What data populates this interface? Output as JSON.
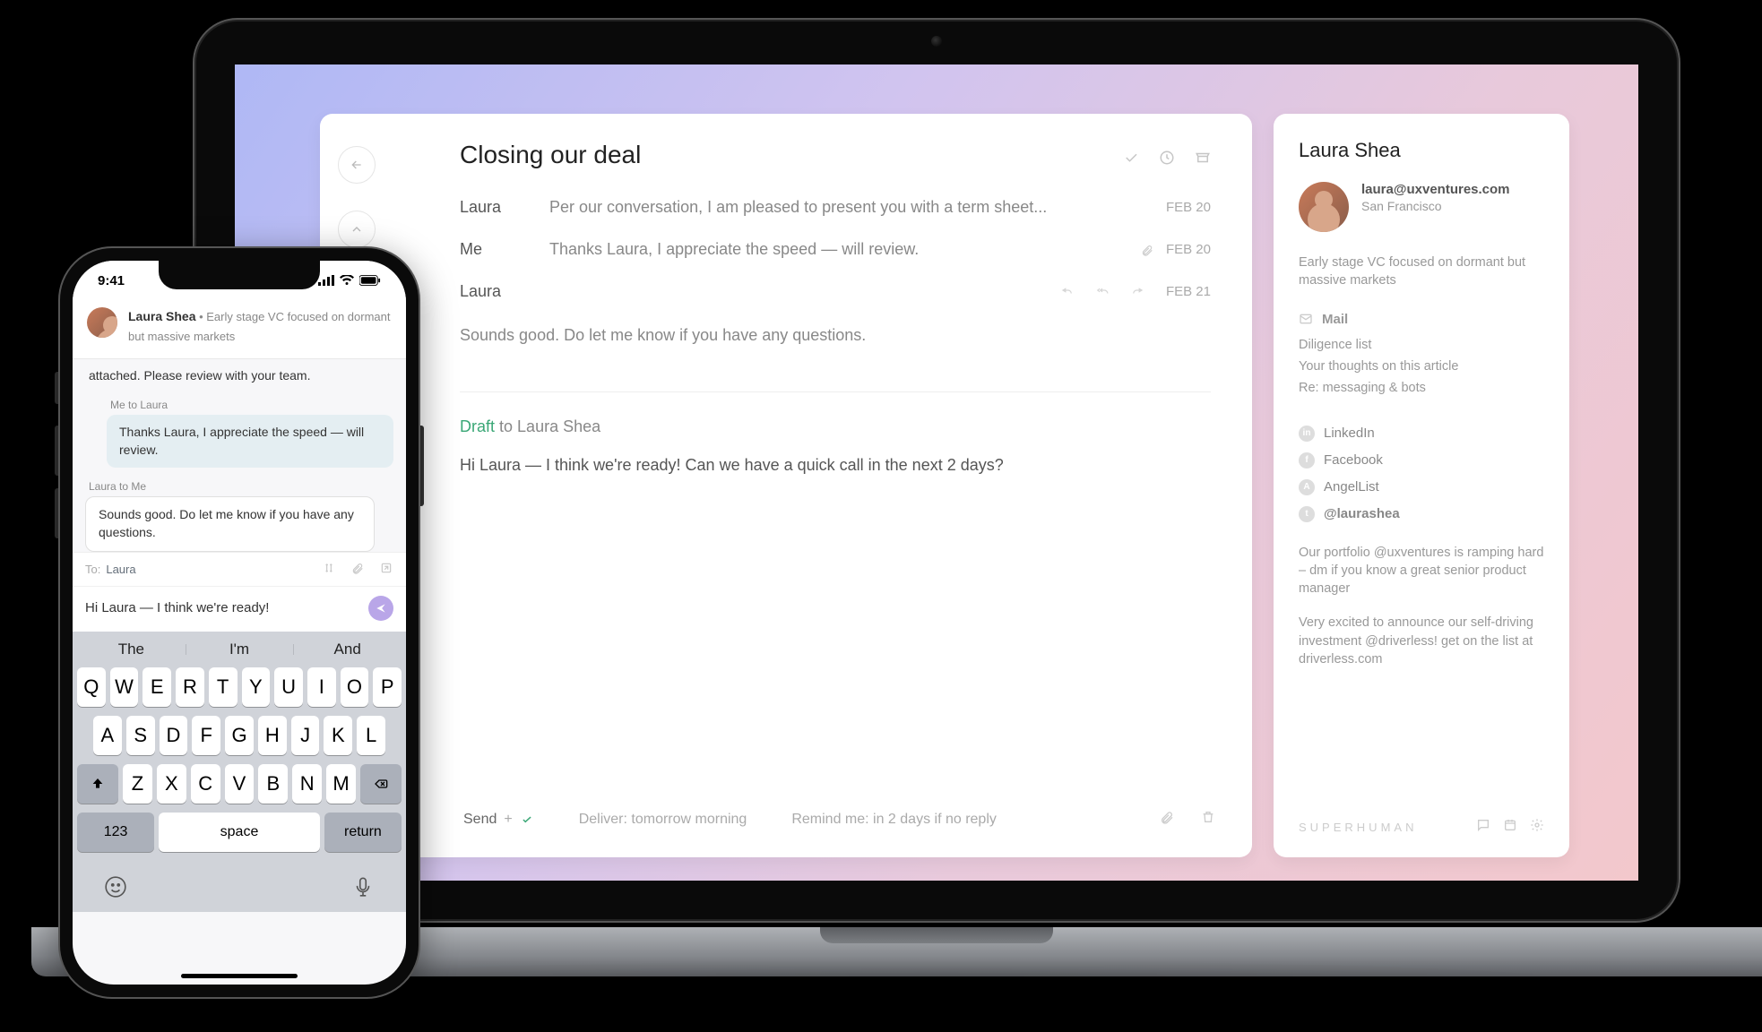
{
  "desktop": {
    "subject": "Closing our deal",
    "messages": [
      {
        "from": "Laura",
        "preview": "Per our conversation, I am pleased to present you with a term sheet...",
        "date": "FEB 20",
        "attached": false
      },
      {
        "from": "Me",
        "preview": "Thanks Laura, I appreciate the speed — will review.",
        "date": "FEB 20",
        "attached": true
      }
    ],
    "expanded": {
      "from": "Laura",
      "date": "FEB 21",
      "body": "Sounds good.  Do let me know if you have any questions."
    },
    "draft": {
      "label": "Draft",
      "to": "to Laura Shea",
      "body": "Hi Laura — I think we're ready! Can we have a quick call in the next 2 days?"
    },
    "compose_bar": {
      "send": "Send",
      "plus": "+",
      "deliver": "Deliver: tomorrow morning",
      "remind": "Remind me: in 2 days if no reply"
    }
  },
  "sidebar": {
    "name": "Laura Shea",
    "email": "laura@uxventures.com",
    "location": "San Francisco",
    "bio": "Early stage VC focused on dormant but massive markets",
    "mail_section": "Mail",
    "mail_items": [
      "Diligence list",
      "Your thoughts on this article",
      "Re: messaging & bots"
    ],
    "socials": [
      {
        "label": "LinkedIn",
        "icon": "in"
      },
      {
        "label": "Facebook",
        "icon": "f"
      },
      {
        "label": "AngelList",
        "icon": "A"
      },
      {
        "label": "@laurashea",
        "icon": "t"
      }
    ],
    "tweets": [
      "Our portfolio @uxventures is ramping hard – dm if you know a great senior product manager",
      "Very excited to announce our self-driving investment @driverless! get on the list at driverless.com"
    ],
    "brand": "SUPERHUMAN"
  },
  "phone": {
    "status_time": "9:41",
    "header_name": "Laura Shea",
    "header_sep": " • ",
    "header_bio": "Early stage VC focused on dormant but massive markets",
    "partial_visible": "attached. Please review with your team.",
    "thread": [
      {
        "meta": "Me to Laura",
        "dir": "out",
        "body": "Thanks Laura, I appreciate the speed — will review."
      },
      {
        "meta": "Laura to Me",
        "dir": "in",
        "body": "Sounds good. Do let me know if you have any questions."
      }
    ],
    "compose": {
      "to_label": "To:",
      "to_name": "Laura",
      "draft_text": "Hi Laura — I think we're ready!"
    },
    "keyboard": {
      "suggestions": [
        "The",
        "I'm",
        "And"
      ],
      "row1": [
        "Q",
        "W",
        "E",
        "R",
        "T",
        "Y",
        "U",
        "I",
        "O",
        "P"
      ],
      "row2": [
        "A",
        "S",
        "D",
        "F",
        "G",
        "H",
        "J",
        "K",
        "L"
      ],
      "row3": [
        "Z",
        "X",
        "C",
        "V",
        "B",
        "N",
        "M"
      ],
      "num_key": "123",
      "space_key": "space",
      "return_key": "return"
    }
  }
}
